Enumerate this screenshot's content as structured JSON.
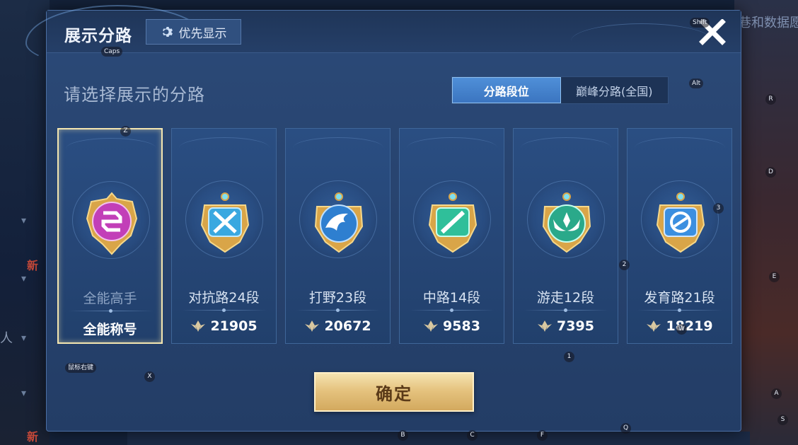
{
  "background": {
    "top_right_text": "巷和数据愿",
    "left_new_tags": [
      "新",
      "新"
    ],
    "left_side_char": "人"
  },
  "dialog": {
    "title": "展示分路",
    "priority_button_label": "优先显示",
    "prompt": "请选择展示的分路",
    "tabs": [
      {
        "label": "分路段位",
        "active": true
      },
      {
        "label": "巅峰分路(全国)",
        "active": false
      }
    ],
    "cards": [
      {
        "name": "全能高手",
        "score": "全能称号",
        "emblem": "all-round-emblem-icon",
        "color": "#c23fb8",
        "selected": true
      },
      {
        "name": "对抗路24段",
        "score": "21905",
        "emblem": "clash-lane-emblem-icon",
        "color": "#3aa8e0",
        "selected": false
      },
      {
        "name": "打野23段",
        "score": "20672",
        "emblem": "jungle-emblem-icon",
        "color": "#2e7fd0",
        "selected": false
      },
      {
        "name": "中路14段",
        "score": "9583",
        "emblem": "mid-lane-emblem-icon",
        "color": "#2fbf9a",
        "selected": false
      },
      {
        "name": "游走12段",
        "score": "7395",
        "emblem": "roam-emblem-icon",
        "color": "#2aa98a",
        "selected": false
      },
      {
        "name": "发育路21段",
        "score": "18219",
        "emblem": "farm-lane-emblem-icon",
        "color": "#3b8fe0",
        "selected": false
      }
    ],
    "confirm_label": "确定"
  },
  "key_hints": {
    "caps": "Caps",
    "shift": "Shift",
    "alt": "Alt",
    "mouse_right": "鼠标右键",
    "z": "Z",
    "x": "X",
    "r": "R",
    "d": "D",
    "e": "E",
    "a": "A",
    "s": "S",
    "q": "Q",
    "f": "F",
    "c": "C",
    "b": "B",
    "w": "W",
    "n1": "1",
    "n2": "2",
    "n3": "3"
  },
  "colors": {
    "dialog_bg": "#284470",
    "tab_active": "#4f8fd8",
    "confirm_gold": "#e5c37f",
    "selected_border": "#f4e6b0"
  }
}
